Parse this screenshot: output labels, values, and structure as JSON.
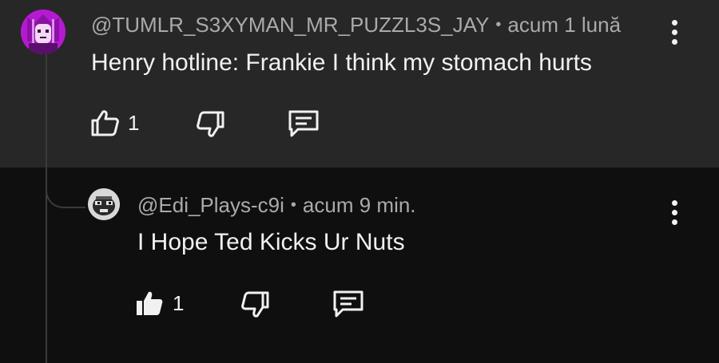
{
  "comment": {
    "author": "@TUMLR_S3XYMAN_MR_PUZZL3S_JAY",
    "separator": "•",
    "time": "acum 1 lună",
    "text": "Henry hotline: Frankie I think my stomach hurts",
    "likes": "1",
    "liked": false
  },
  "reply": {
    "author": "@Edi_Plays-c9i",
    "separator": "•",
    "time": "acum 9 min.",
    "text": "I Hope Ted Kicks Ur Nuts",
    "likes": "1",
    "liked": true
  },
  "colors": {
    "top_background": "#272727",
    "reply_background": "#0f0f0f",
    "text_primary": "#f1f1f1",
    "text_secondary": "#aaaaaa",
    "avatar_main": "#b51ad2"
  },
  "icons": {
    "like": "thumbs-up-icon",
    "dislike": "thumbs-down-icon",
    "reply": "reply-comment-icon",
    "more": "more-vertical-icon"
  }
}
